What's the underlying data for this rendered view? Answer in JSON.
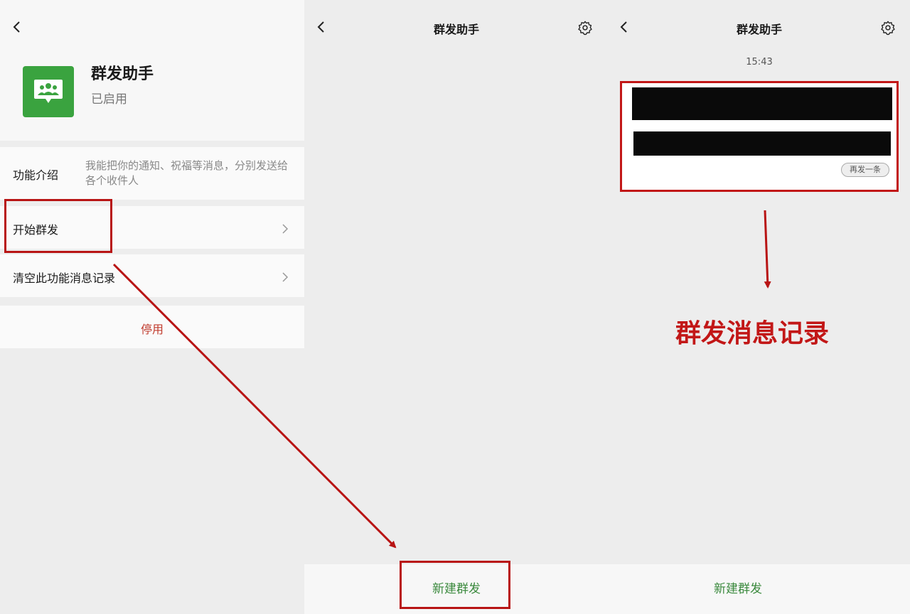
{
  "panel1": {
    "app_name": "群发助手",
    "status": "已启用",
    "intro_label": "功能介绍",
    "intro_desc": "我能把你的通知、祝福等消息，分别发送给各个收件人",
    "start_label": "开始群发",
    "clear_label": "清空此功能消息记录",
    "disable_label": "停用"
  },
  "panel2": {
    "title": "群发助手",
    "new_button": "新建群发"
  },
  "panel3": {
    "title": "群发助手",
    "time": "15:43",
    "resend_label": "再发一条",
    "annotation": "群发消息记录",
    "new_button": "新建群发"
  },
  "colors": {
    "accent_green": "#3aa33f",
    "highlight_red": "#c21717"
  }
}
